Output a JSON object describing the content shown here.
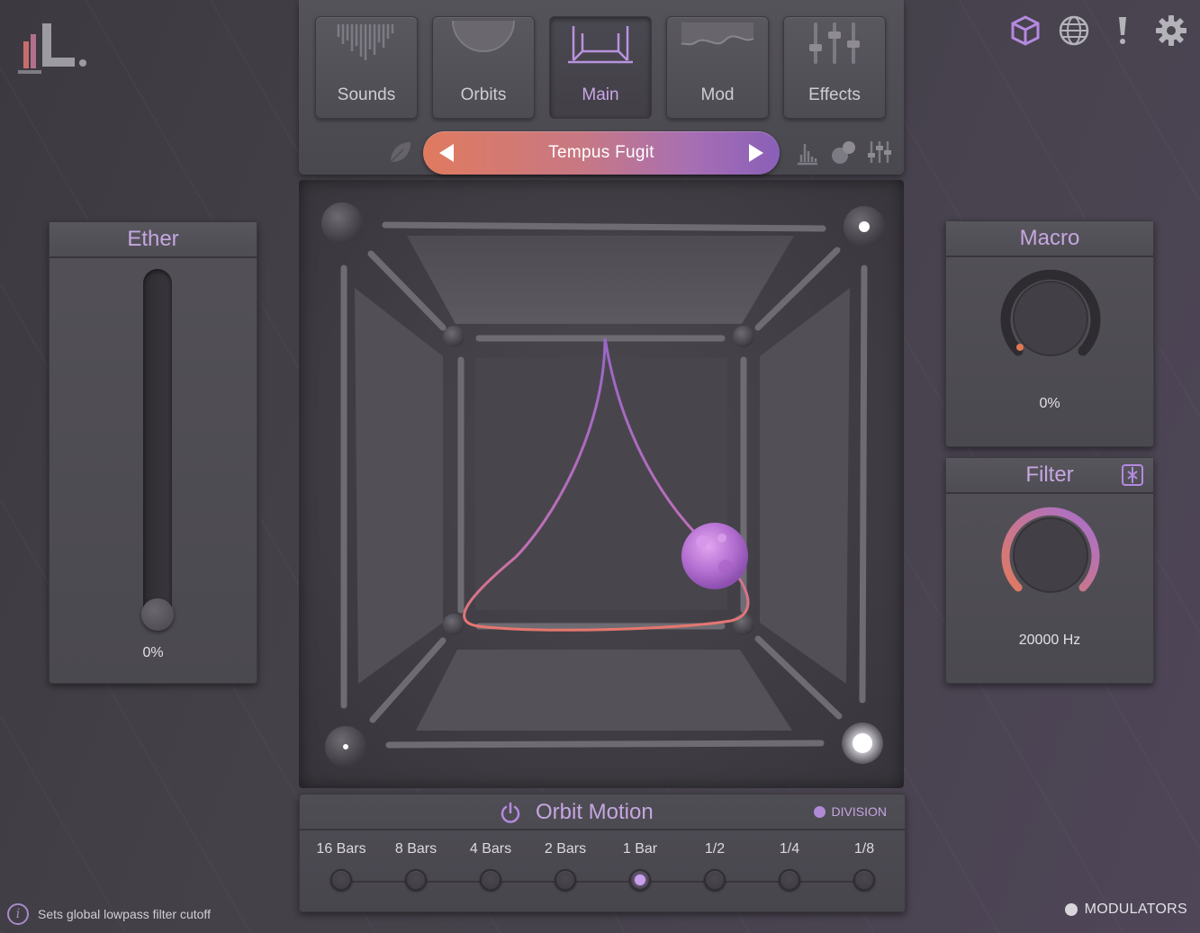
{
  "tabs": [
    {
      "label": "Sounds",
      "icon": "waveform-icon",
      "active": false
    },
    {
      "label": "Orbits",
      "icon": "orbit-arc-icon",
      "active": false
    },
    {
      "label": "Main",
      "icon": "cube-frame-icon",
      "active": true
    },
    {
      "label": "Mod",
      "icon": "wave-line-icon",
      "active": false
    },
    {
      "label": "Effects",
      "icon": "faders-icon",
      "active": false
    }
  ],
  "preset": {
    "name": "Tempus Fugit"
  },
  "ether": {
    "title": "Ether",
    "value": "0%",
    "level": 0
  },
  "macro": {
    "title": "Macro",
    "value": "0%",
    "level": 0
  },
  "filter": {
    "title": "Filter",
    "value": "20000 Hz",
    "level": 1
  },
  "orbit_motion": {
    "title": "Orbit Motion",
    "division_label": "DIVISION",
    "divisions": [
      "16 Bars",
      "8 Bars",
      "4 Bars",
      "2 Bars",
      "1 Bar",
      "1/2",
      "1/4",
      "1/8"
    ],
    "selected": "1 Bar"
  },
  "status": {
    "text": "Sets global lowpass filter cutoff"
  },
  "modulators": {
    "label": "MODULATORS"
  },
  "colors": {
    "accent": "#c5a6e0",
    "preset_start": "#e07a5f",
    "preset_end": "#8a5fb8",
    "orbit_path": "#a970d0",
    "sphere": "#c07ad8"
  }
}
